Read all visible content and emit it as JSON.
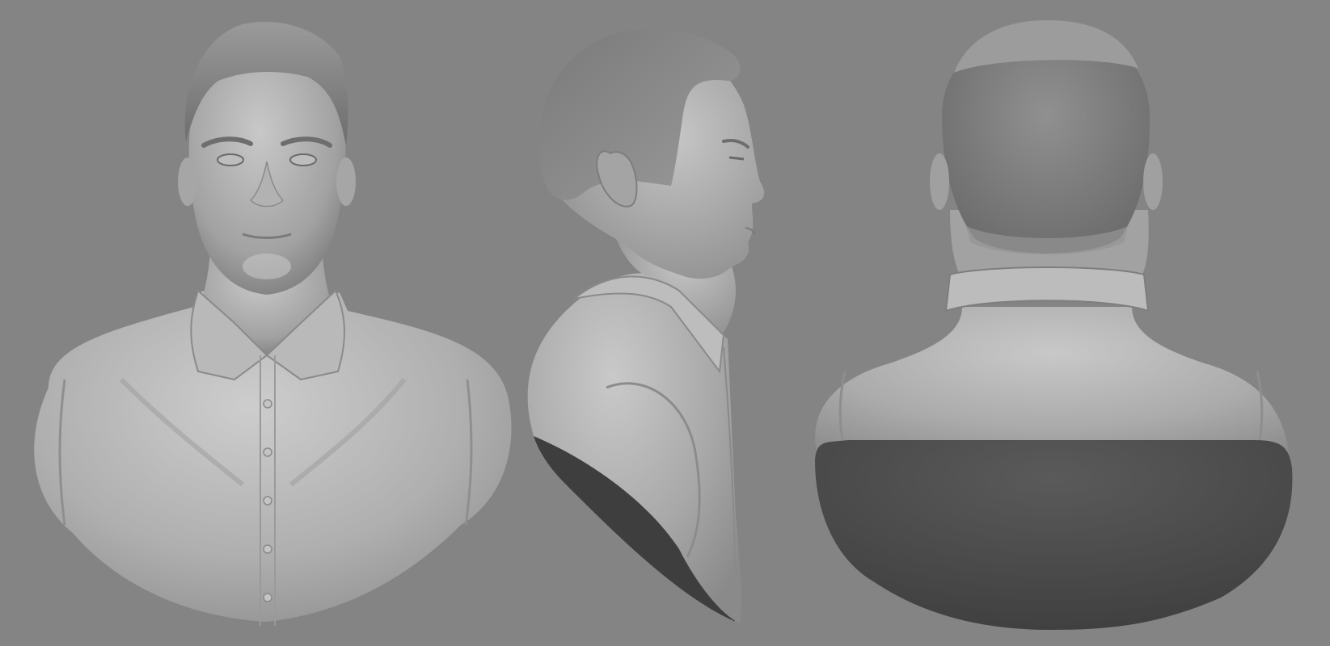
{
  "scene": {
    "background_color": "#848484",
    "material_color": "#b4b4b4",
    "shadow_color": "#4a4a4a",
    "views": [
      {
        "id": "front",
        "label": ""
      },
      {
        "id": "side",
        "label": ""
      },
      {
        "id": "back",
        "label": ""
      }
    ]
  }
}
